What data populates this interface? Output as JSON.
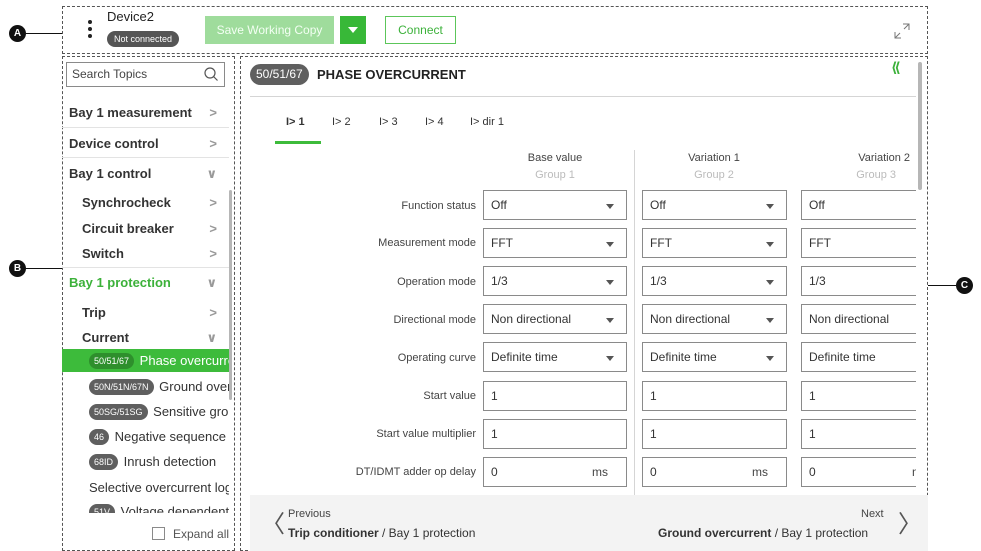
{
  "markers": {
    "a": "A",
    "b": "B",
    "c": "C"
  },
  "toolbar": {
    "device_name": "Device2",
    "status": "Not connected",
    "save_label": "Save Working Copy",
    "connect_label": "Connect"
  },
  "sidebar": {
    "search_placeholder": "Search Topics",
    "items": [
      {
        "label": "Bay 1 measurement"
      },
      {
        "label": "Device control"
      },
      {
        "label": "Bay 1 control"
      },
      {
        "label": "Synchrocheck"
      },
      {
        "label": "Circuit breaker"
      },
      {
        "label": "Switch"
      },
      {
        "label": "Bay 1 protection"
      },
      {
        "label": "Trip"
      },
      {
        "label": "Current"
      }
    ],
    "leaves": [
      {
        "chip": "50/51/67",
        "label": "Phase overcurrent"
      },
      {
        "chip": "50N/51N/67N",
        "label": "Ground overcurrent"
      },
      {
        "chip": "50SG/51SG",
        "label": "Sensitive ground"
      },
      {
        "chip": "46",
        "label": "Negative sequence"
      },
      {
        "chip": "68ID",
        "label": "Inrush detection"
      },
      {
        "label": "Selective overcurrent logic"
      },
      {
        "chip": "51V",
        "label": "Voltage dependent"
      }
    ],
    "expand_all": "Expand all"
  },
  "main": {
    "code": "50/51/67",
    "title": "PHASE OVERCURRENT",
    "tabs": [
      "I> 1",
      "I> 2",
      "I> 3",
      "I> 4",
      "I> dir 1"
    ],
    "columns": [
      {
        "title": "Base value",
        "group": "Group 1"
      },
      {
        "title": "Variation 1",
        "group": "Group 2"
      },
      {
        "title": "Variation 2",
        "group": "Group 3"
      }
    ],
    "rows": [
      {
        "label": "Function status",
        "values": [
          "Off",
          "Off",
          "Off"
        ]
      },
      {
        "label": "Measurement mode",
        "values": [
          "FFT",
          "FFT",
          "FFT"
        ]
      },
      {
        "label": "Operation mode",
        "values": [
          "1/3",
          "1/3",
          "1/3"
        ]
      },
      {
        "label": "Directional mode",
        "values": [
          "Non directional",
          "Non directional",
          "Non directional"
        ]
      },
      {
        "label": "Operating curve",
        "values": [
          "Definite time",
          "Definite time",
          "Definite time"
        ]
      },
      {
        "label": "Start value",
        "values": [
          "1",
          "1",
          "1"
        ]
      },
      {
        "label": "Start value multiplier",
        "values": [
          "1",
          "1",
          "1"
        ]
      },
      {
        "label": "DT/IDMT adder op delay",
        "values": [
          "0",
          "0",
          "0"
        ],
        "unit": "ms"
      }
    ]
  },
  "footer": {
    "prev_caption": "Previous",
    "prev_title": "Trip conditioner",
    "prev_context": " / Bay 1 protection",
    "next_caption": "Next",
    "next_title": "Ground overcurrent",
    "next_context": " / Bay 1 protection"
  }
}
